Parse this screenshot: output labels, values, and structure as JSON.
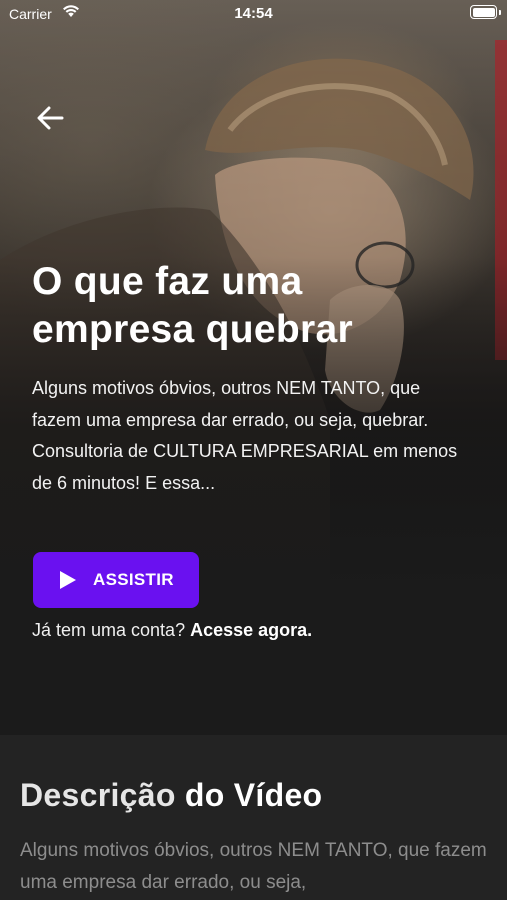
{
  "status_bar": {
    "carrier": "Carrier",
    "time": "14:54"
  },
  "hero": {
    "title": "O que faz uma empresa quebrar",
    "summary": "Alguns motivos óbvios, outros NEM TANTO, que fazem uma empresa dar errado, ou seja, quebrar. Consultoria de CULTURA EMPRESARIAL em menos de 6 minutos! E essa...",
    "watch_button": "ASSISTIR",
    "login_prompt": "Já tem uma conta?",
    "login_link": "Acesse agora."
  },
  "description": {
    "heading_light": "Descrição",
    "heading_bold": "do Vídeo",
    "text": "Alguns motivos óbvios, outros NEM TANTO, que fazem uma empresa dar errado, ou seja,"
  },
  "colors": {
    "accent": "#6a11f0",
    "background": "#1b1b1b",
    "section_background": "#232323"
  }
}
